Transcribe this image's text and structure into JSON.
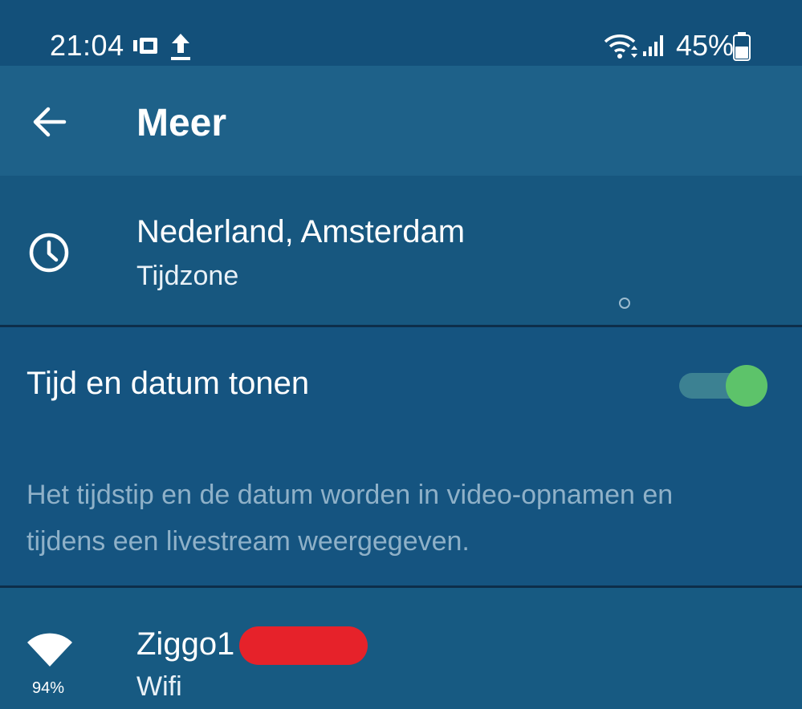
{
  "status_bar": {
    "time": "21:04",
    "battery_percent": "45%",
    "icons": [
      "screen-record-icon",
      "upload-icon",
      "wifi-signal-icon",
      "cellular-signal-icon",
      "battery-icon"
    ]
  },
  "app_bar": {
    "title": "Meer",
    "back_icon": "arrow-left-icon"
  },
  "timezone": {
    "value": "Nederland, Amsterdam",
    "label": "Tijdzone",
    "icon": "clock-icon"
  },
  "time_date_setting": {
    "label": "Tijd en datum tonen",
    "enabled": true,
    "description": "Het tijdstip en de datum worden in video-opnamen en tijdens een livestream weergegeven.",
    "toggle_color_on": "#5dc36a"
  },
  "wifi": {
    "network_name": "Ziggo1",
    "label": "Wifi",
    "signal": "94%",
    "icon": "wifi-icon",
    "redaction_color": "#e6222a"
  },
  "colors": {
    "background": "#14547e",
    "app_bar": "#1e6189",
    "description_text": "#8fb1c8"
  }
}
